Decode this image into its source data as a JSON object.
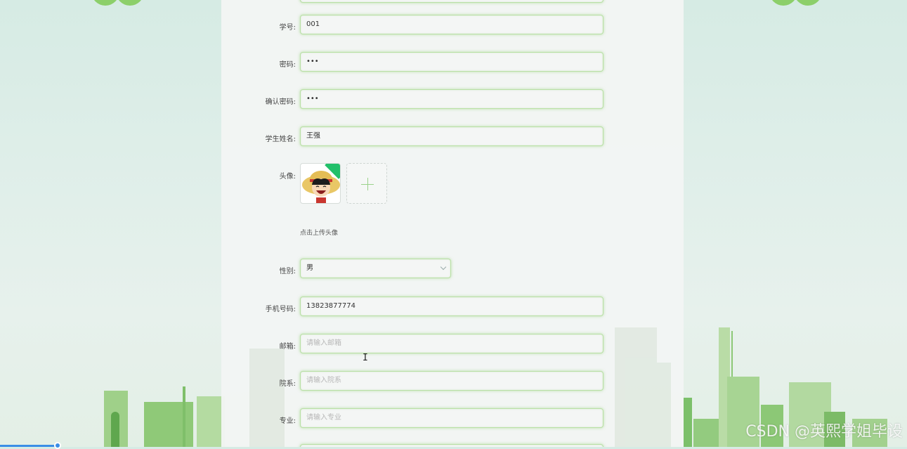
{
  "form": {
    "student_id": {
      "label": "学号:",
      "value": "001"
    },
    "password": {
      "label": "密码:",
      "value": "•••"
    },
    "confirm_password": {
      "label": "确认密码:",
      "value": "•••"
    },
    "student_name": {
      "label": "学生姓名:",
      "value": "王强"
    },
    "avatar": {
      "label": "头像:",
      "tip": "点击上传头像"
    },
    "gender": {
      "label": "性别:",
      "value": "男"
    },
    "phone": {
      "label": "手机号码:",
      "value": "13823877774"
    },
    "email": {
      "label": "邮箱:",
      "placeholder": "请输入邮箱"
    },
    "department": {
      "label": "院系:",
      "placeholder": "请输入院系"
    },
    "major": {
      "label": "专业:",
      "placeholder": "请输入专业"
    }
  },
  "watermark": "CSDN @英熙学姐毕设",
  "colors": {
    "accent": "#8ccf6a",
    "field_border": "#b9e0a5"
  }
}
